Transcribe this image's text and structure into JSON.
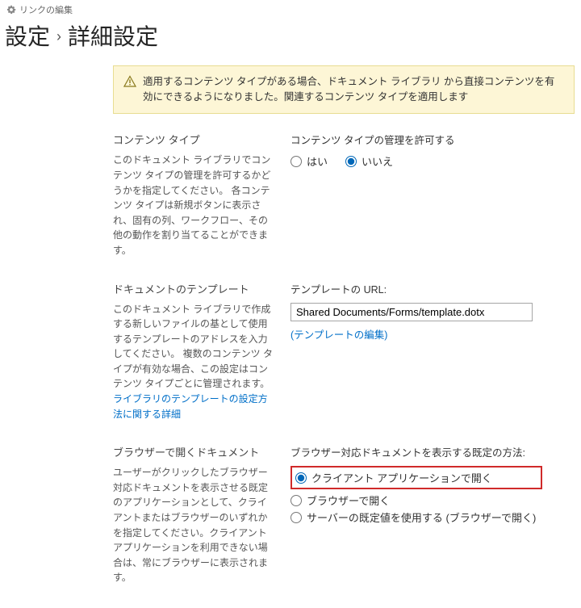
{
  "editLink": {
    "label": "リンクの編集"
  },
  "breadcrumb": {
    "item1": "設定",
    "item2": "詳細設定"
  },
  "notice": {
    "text": "適用するコンテンツ タイプがある場合、ドキュメント ライブラリ から直接コンテンツを有効にできるようになりました。関連するコンテンツ タイプを適用します"
  },
  "sections": {
    "contentType": {
      "title": "コンテンツ タイプ",
      "desc": "このドキュメント ライブラリでコンテンツ タイプの管理を許可するかどうかを指定してください。 各コンテンツ タイプは新規ボタンに表示され、固有の列、ワークフロー、その他の動作を割り当てることができます。",
      "fieldLabel": "コンテンツ タイプの管理を許可する",
      "optYes": "はい",
      "optNo": "いいえ"
    },
    "template": {
      "title": "ドキュメントのテンプレート",
      "descBefore": "このドキュメント ライブラリで作成する新しいファイルの基として使用するテンプレートのアドレスを入力してください。 複数のコンテンツ タイプが有効な場合、この設定はコンテンツ タイプごとに管理されます。",
      "descLink": "ライブラリのテンプレートの設定方法に関する詳細",
      "fieldLabel": "テンプレートの URL:",
      "value": "Shared Documents/Forms/template.dotx",
      "editLink": "(テンプレートの編集)"
    },
    "openIn": {
      "title": "ブラウザーで開くドキュメント",
      "desc": "ユーザーがクリックしたブラウザー対応ドキュメントを表示させる既定のアプリケーションとして、クライアントまたはブラウザーのいずれかを指定してください。クライアント アプリケーションを利用できない場合は、常にブラウザーに表示されます。",
      "fieldLabel": "ブラウザー対応ドキュメントを表示する既定の方法:",
      "optClient": "クライアント アプリケーションで開く",
      "optBrowser": "ブラウザーで開く",
      "optServer": "サーバーの既定値を使用する (ブラウザーで開く)"
    }
  }
}
